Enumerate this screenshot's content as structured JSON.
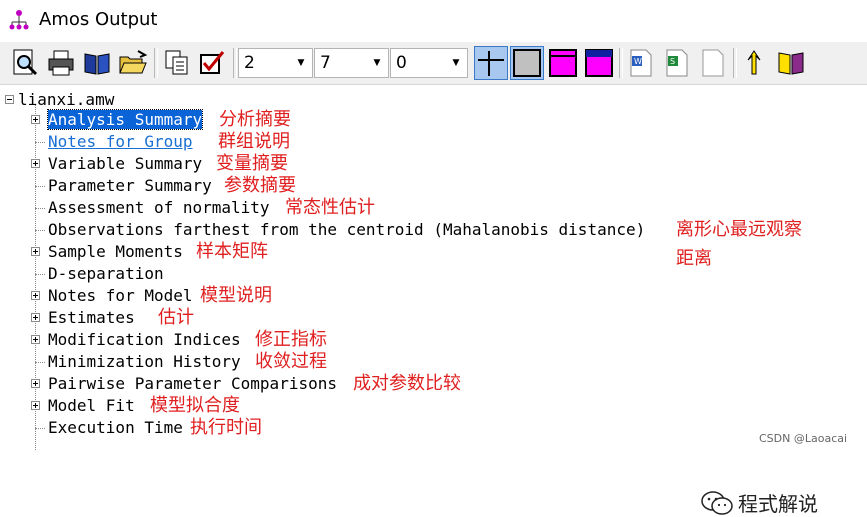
{
  "window": {
    "title": "Amos Output"
  },
  "toolbar": {
    "combo1_value": "2",
    "combo2_value": "7",
    "combo3_value": "0",
    "icons": [
      "print-preview-icon",
      "print-icon",
      "book-icon",
      "open-folder-icon",
      "copy-icon",
      "checkbox-icon",
      "table-lines-icon",
      "gray-box-icon",
      "magenta-box-icon",
      "magenta-blue-box-icon",
      "word-doc-icon",
      "excel-doc-icon",
      "blank-doc-icon",
      "pointer-icon",
      "reference-book-icon"
    ]
  },
  "tree": {
    "root": "lianxi.amw",
    "items": [
      {
        "label": "Analysis Summary",
        "annotation": "分析摘要",
        "expandable": true,
        "selected": true
      },
      {
        "label": "Notes for Group",
        "annotation": "群组说明",
        "expandable": false,
        "link": true
      },
      {
        "label": "Variable Summary",
        "annotation": "变量摘要",
        "expandable": true
      },
      {
        "label": "Parameter Summary",
        "annotation": "参数摘要",
        "expandable": false
      },
      {
        "label": "Assessment of normality",
        "annotation": "常态性估计",
        "expandable": false
      },
      {
        "label": "Observations farthest from the centroid (Mahalanobis distance)",
        "annotation": "离形心最远观察",
        "annotation2": "距离",
        "expandable": false
      },
      {
        "label": "Sample Moments",
        "annotation": "样本矩阵",
        "expandable": true
      },
      {
        "label": "D-separation",
        "annotation": "",
        "expandable": false
      },
      {
        "label": "Notes for Model",
        "annotation": "模型说明",
        "expandable": true
      },
      {
        "label": "Estimates",
        "annotation": "估计",
        "expandable": true
      },
      {
        "label": "Modification Indices",
        "annotation": "修正指标",
        "expandable": true
      },
      {
        "label": "Minimization History",
        "annotation": "收敛过程",
        "expandable": false
      },
      {
        "label": "Pairwise Parameter Comparisons",
        "annotation": "成对参数比较",
        "expandable": true
      },
      {
        "label": "Model Fit",
        "annotation": "模型拟合度",
        "expandable": true
      },
      {
        "label": "Execution Time",
        "annotation": "执行时间",
        "expandable": false
      }
    ]
  },
  "watermark": {
    "text": "程式解说",
    "csdn": "CSDN @Laoacai"
  },
  "colors": {
    "selection": "#0a64d8",
    "annotation": "#e02020",
    "link": "#1a6fd4",
    "magenta": "#ff00ff"
  }
}
